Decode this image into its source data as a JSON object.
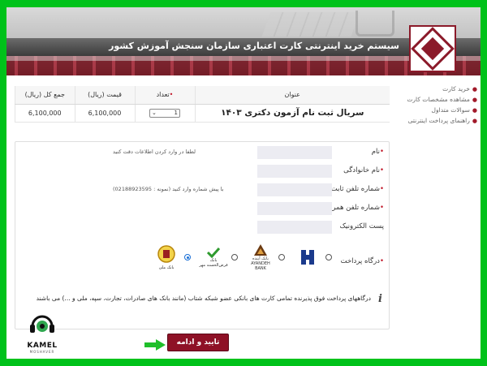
{
  "header": {
    "title": "سیستم خرید اینترنتی کارت اعتباری سازمان سنجش آموزش کشور"
  },
  "sidebar": {
    "items": [
      {
        "label": "خرید کارت"
      },
      {
        "label": "مشاهده مشخصات کارت"
      },
      {
        "label": "سوالات متداول"
      },
      {
        "label": "راهنمای پرداخت اینترنتی"
      }
    ]
  },
  "order_table": {
    "headers": {
      "title": "عنوان",
      "quantity": "تعداد",
      "price": "قیمت (ریال)",
      "total": "جمع کل (ریال)"
    },
    "row": {
      "title": "سریال ثبت نام آزمون دکتری ۱۴۰۳",
      "quantity": "1",
      "price": "6,100,000",
      "total": "6,100,000"
    }
  },
  "form": {
    "first_name": {
      "label": "نام",
      "hint": "لطفا در وارد کردن اطلاعات دقت کنید"
    },
    "last_name": {
      "label": "نام خانوادگی"
    },
    "phone": {
      "label": "شماره تلفن ثابت",
      "hint": "با پیش شماره وارد کنید (نمونه : 02188923595)"
    },
    "mobile": {
      "label": "شماره تلفن همراه"
    },
    "email": {
      "label": "پست الکترونیک"
    },
    "gateway": {
      "label": "درگاه پرداخت",
      "banks": [
        {
          "name": "بانک ملی",
          "selected": true
        },
        {
          "name": "بانک قرض‌الحسنه مهر",
          "selected": false
        },
        {
          "name": "بانک آینده",
          "sub": "AYANDEH BANK",
          "selected": false
        },
        {
          "name": "بانک صنعت",
          "selected": false
        }
      ]
    },
    "note": "درگاههای پرداخت فوق پذیرنده تمامی کارت های بانکی عضو شبکه شتاب (مانند بانک های صادرات، تجارت، سپه، ملی و ...) می باشند"
  },
  "actions": {
    "submit_label": "تایید و ادامه"
  },
  "watermark": {
    "name": "KAMEL",
    "sub": "MOSHAVER"
  },
  "colors": {
    "outer_bg": "#00c21a",
    "brand": "#8e1126",
    "required": "#c0182a",
    "arrow": "#1fbf2a"
  }
}
